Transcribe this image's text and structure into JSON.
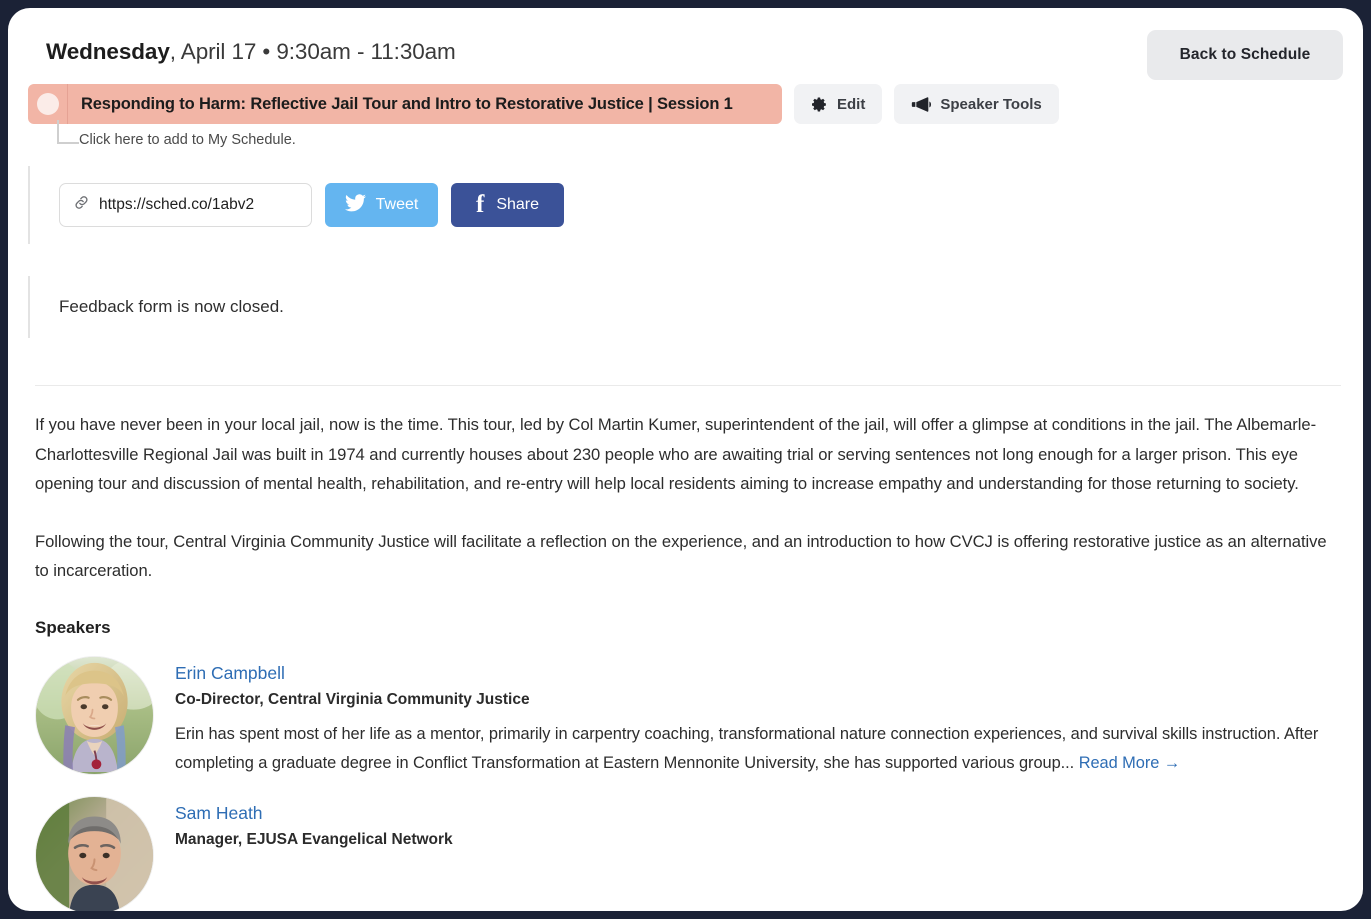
{
  "header": {
    "day_of_week": "Wednesday",
    "date_and_time": ", April 17 • 9:30am - 11:30am",
    "back_button": "Back to Schedule"
  },
  "session": {
    "title": "Responding to Harm: Reflective Jail Tour and Intro to Restorative Justice | Session 1",
    "bar_color": "#f2b5a6",
    "edit_button": "Edit",
    "speaker_tools_button": "Speaker Tools",
    "add_to_schedule_hint": "Click here to add to My Schedule."
  },
  "share": {
    "url": "https://sched.co/1abv2",
    "tweet_label": "Tweet",
    "tweet_color": "#64b5f0",
    "share_label": "Share",
    "share_color": "#3b5298"
  },
  "feedback": {
    "message": "Feedback form is now closed."
  },
  "description": {
    "paragraph_1": "If you have never been in your local jail, now is the time. This tour, led by Col Martin Kumer, superintendent of the jail, will offer a glimpse at conditions in the jail. The Albemarle-Charlottesville Regional Jail was built in 1974 and currently houses about 230 people who are awaiting trial or serving sentences not long enough for a larger prison. This eye opening tour and discussion of mental health, rehabilitation, and re-entry will help local residents aiming to increase empathy and understanding for those returning to society.",
    "paragraph_2": "Following the tour, Central Virginia Community Justice will facilitate a reflection on the experience, and an introduction to how CVCJ is offering restorative justice as an alternative to incarceration."
  },
  "speakers_section": {
    "heading": "Speakers",
    "read_more_label": "Read More →",
    "speakers": [
      {
        "name": "Erin Campbell",
        "role": "Co-Director, Central Virginia Community Justice",
        "bio": "Erin has spent most of her life as a mentor, primarily in carpentry coaching, transformational nature connection experiences, and survival skills instruction. After completing a graduate degree in Conflict Transformation at Eastern Mennonite University, she has supported various group...",
        "avatar": "portrait-blonde-woman-outdoors"
      },
      {
        "name": "Sam Heath",
        "role": "Manager, EJUSA Evangelical Network",
        "bio": "",
        "avatar": "portrait-man-gray-hair"
      }
    ]
  },
  "icons": {
    "gear": "gear-icon",
    "megaphone": "megaphone-icon",
    "link": "link-icon",
    "twitter": "twitter-bird-icon",
    "facebook": "facebook-f-icon"
  }
}
